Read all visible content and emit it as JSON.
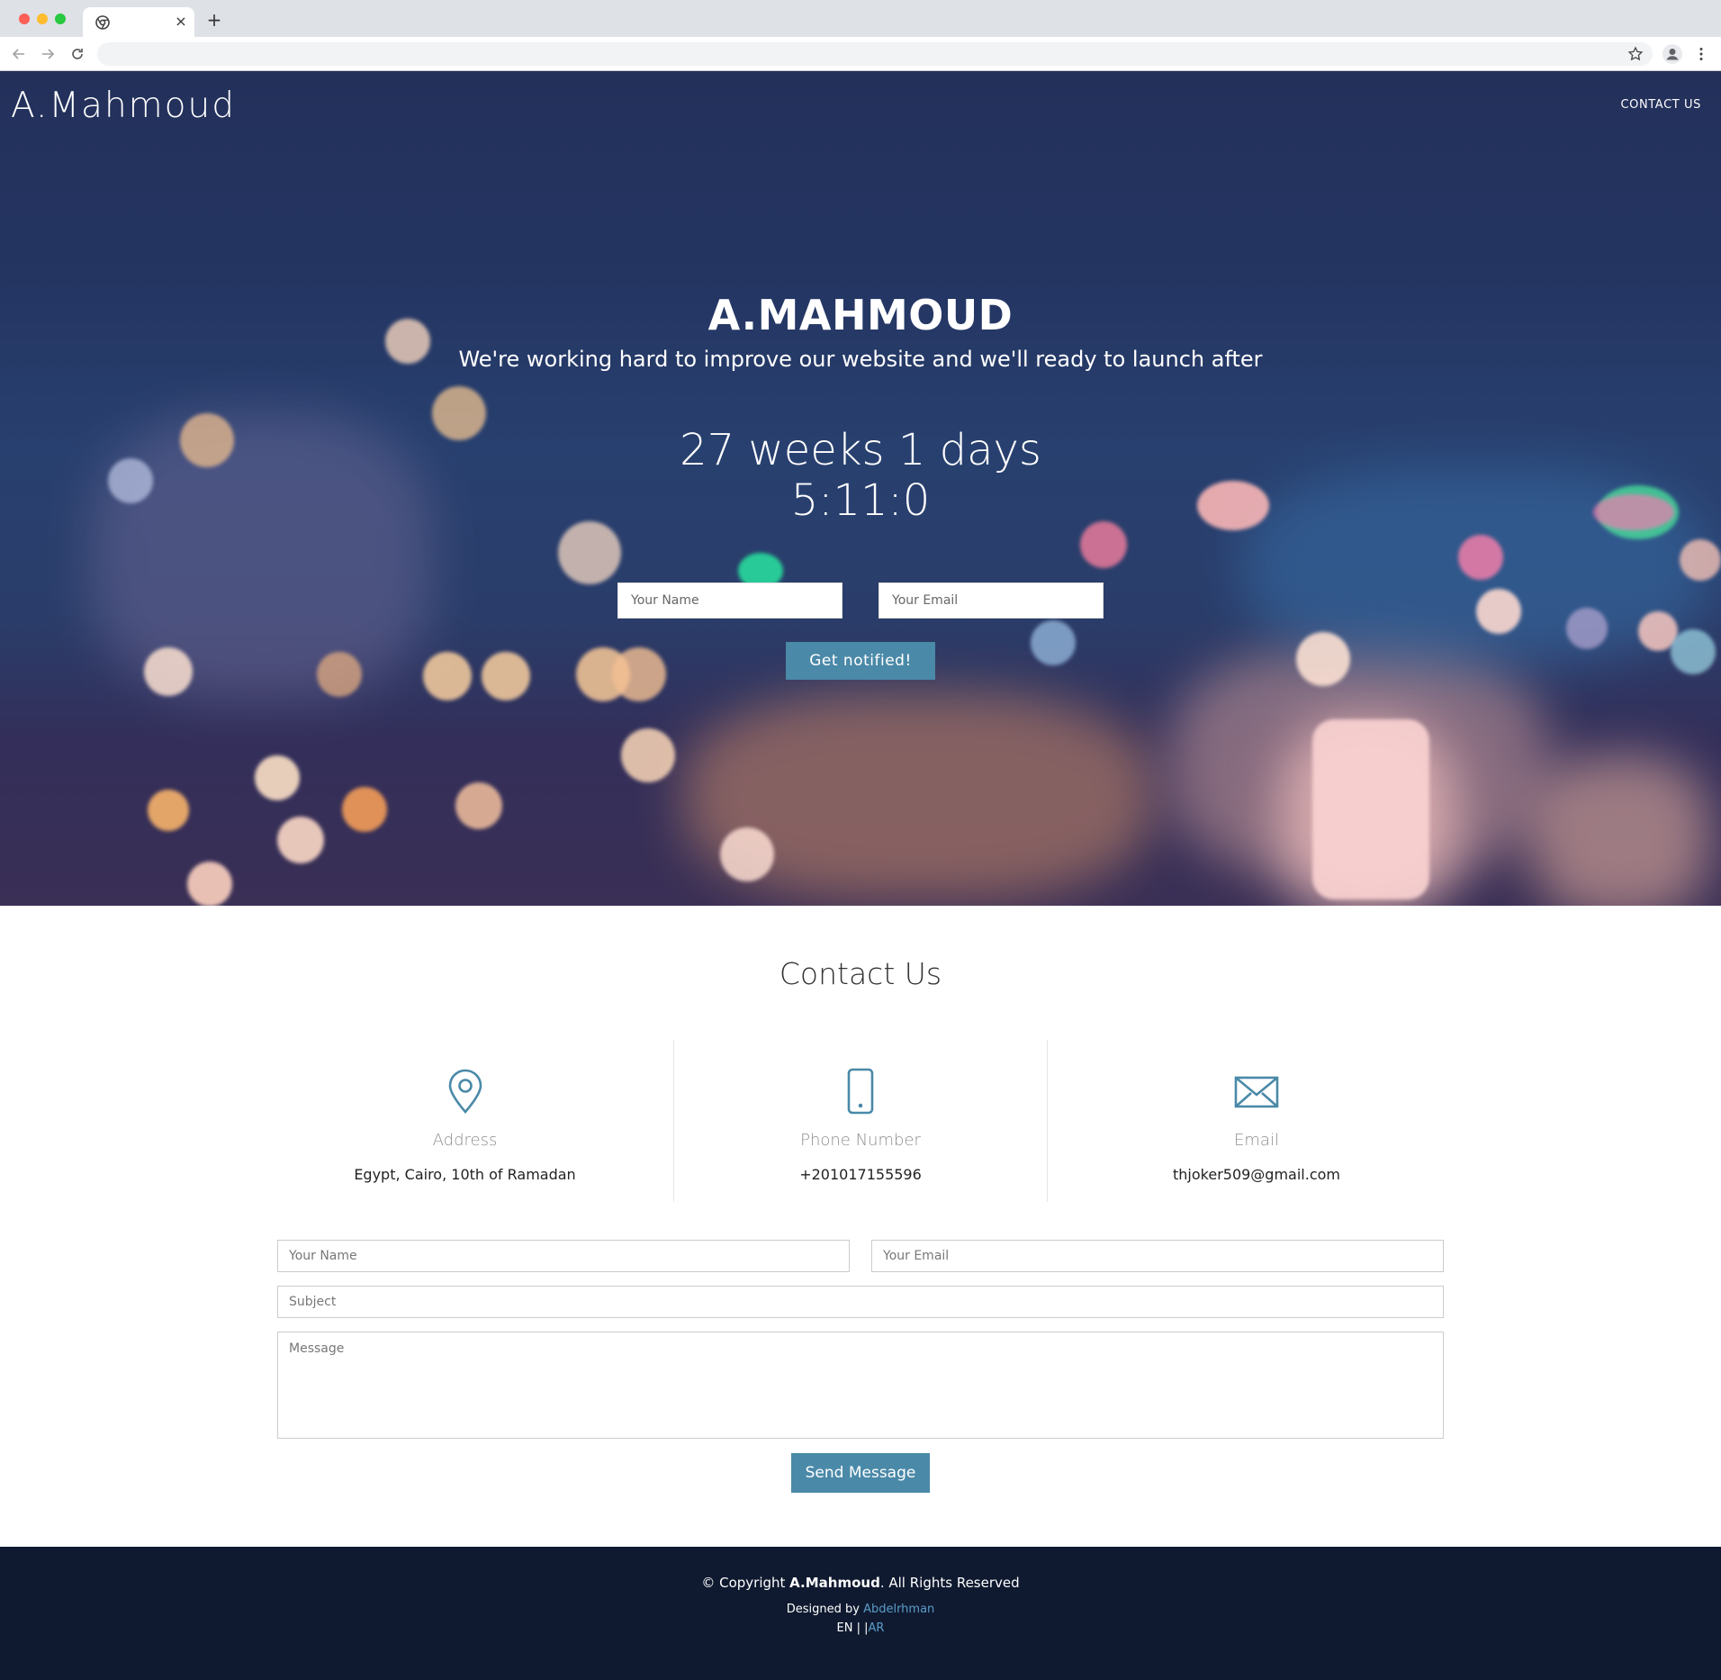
{
  "browser": {
    "tab_close_glyph": "×",
    "new_tab_glyph": "+",
    "icons": [
      "chrome-favicon-icon",
      "back-arrow-icon",
      "forward-arrow-icon",
      "reload-icon",
      "star-icon",
      "profile-icon",
      "kebab-menu-icon"
    ]
  },
  "header": {
    "brand": "A.Mahmoud",
    "nav_contact": "CONTACT US"
  },
  "hero": {
    "title": "A.MAHMOUD",
    "subtitle": "We're working hard to improve our website and we'll ready to launch after",
    "countdown_line1": "27 weeks 1 days",
    "countdown_line2": "5:11:0",
    "name_placeholder": "Your Name",
    "email_placeholder": "Your Email",
    "notify_label": "Get notified!"
  },
  "contact": {
    "title": "Contact Us",
    "info": [
      {
        "icon": "map-pin-icon",
        "label": "Address",
        "value": "Egypt, Cairo, 10th of Ramadan"
      },
      {
        "icon": "phone-icon",
        "label": "Phone Number",
        "value": "+201017155596"
      },
      {
        "icon": "envelope-icon",
        "label": "Email",
        "value": "thjoker509@gmail.com"
      }
    ],
    "form": {
      "name_placeholder": "Your Name",
      "email_placeholder": "Your Email",
      "subject_placeholder": "Subject",
      "message_placeholder": "Message",
      "send_label": "Send Message"
    }
  },
  "footer": {
    "copyright_prefix": "© Copyright ",
    "copyright_brand": "A.Mahmoud",
    "copyright_suffix": ". All Rights Reserved",
    "designed_prefix": "Designed by ",
    "designer": "Abdelrhman",
    "lang_en": "EN",
    "lang_sep": " | |",
    "lang_ar": "AR"
  },
  "colors": {
    "accent": "#4a89a8",
    "footer_bg": "#0f1a30",
    "hero_bg": "#243562",
    "link": "#5b9cc8"
  }
}
